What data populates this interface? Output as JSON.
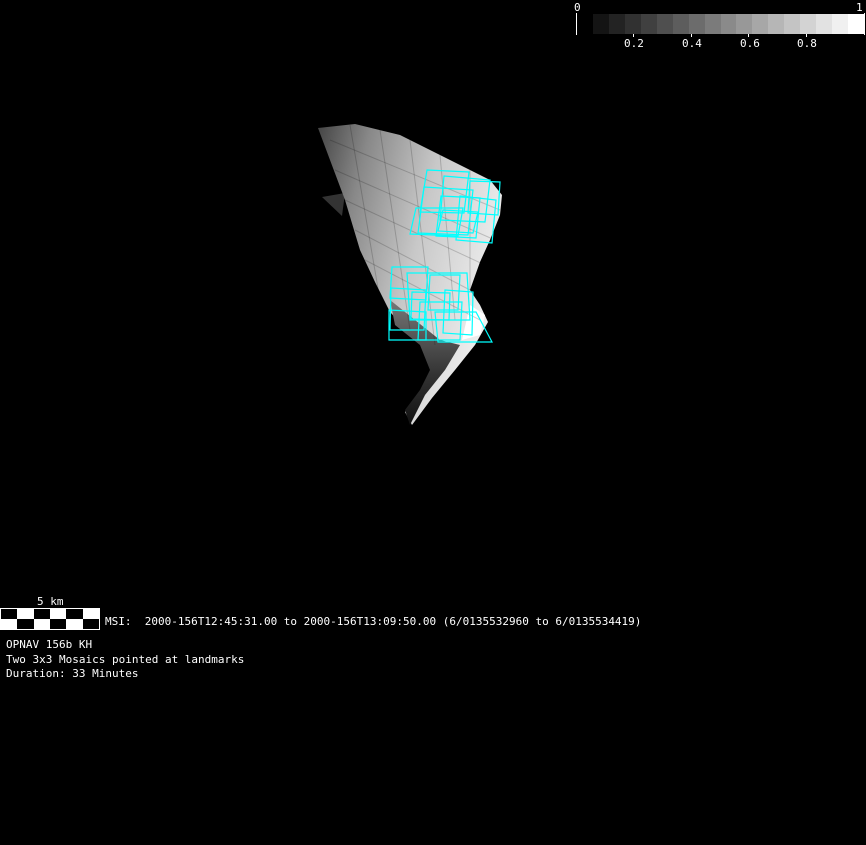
{
  "colorbar": {
    "min_label": "0",
    "max_label": "1",
    "tick_labels": [
      "0.2",
      "0.4",
      "0.6",
      "0.8"
    ],
    "steps": 17
  },
  "scale_bar": {
    "label": "5 km"
  },
  "msi_line": "MSI:  2000-156T12:45:31.00 to 2000-156T13:09:50.00 (6/0135532960 to 6/0135534419)",
  "info": {
    "title": "OPNAV 156b KH",
    "description": "Two 3x3 Mosaics pointed at landmarks",
    "duration": "Duration: 33 Minutes"
  },
  "colors": {
    "footprint": "#00ffff",
    "background": "#000000"
  }
}
